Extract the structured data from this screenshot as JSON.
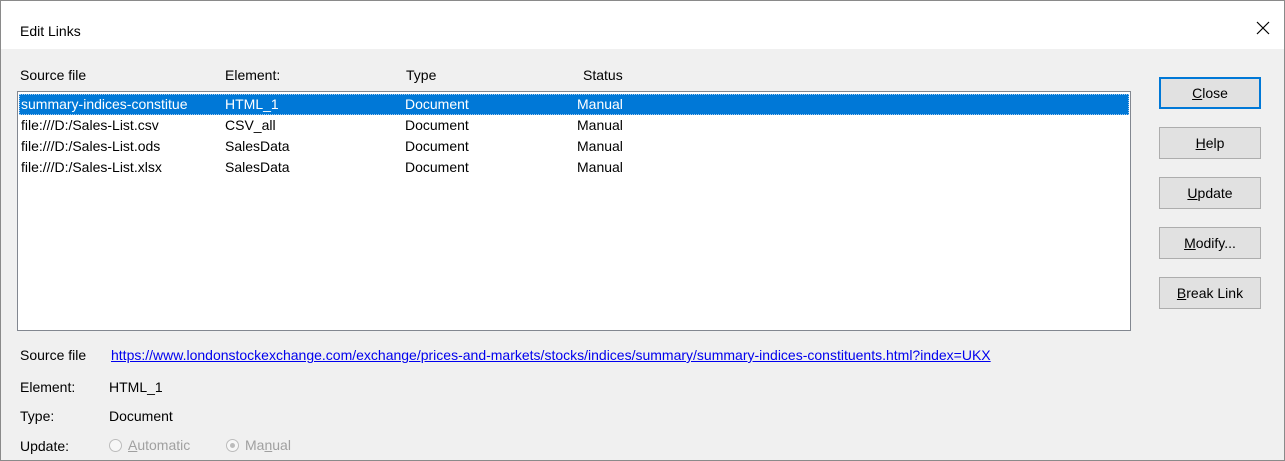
{
  "window": {
    "title": "Edit Links"
  },
  "columns": {
    "source": "Source file",
    "element": "Element:",
    "type": "Type",
    "status": "Status"
  },
  "links": [
    {
      "source": "summary-indices-constitue",
      "element": "HTML_1",
      "type": "Document",
      "status": "Manual"
    },
    {
      "source": "file:///D:/Sales-List.csv",
      "element": "CSV_all",
      "type": "Document",
      "status": "Manual"
    },
    {
      "source": "file:///D:/Sales-List.ods",
      "element": "SalesData",
      "type": "Document",
      "status": "Manual"
    },
    {
      "source": "file:///D:/Sales-List.xlsx",
      "element": "SalesData",
      "type": "Document",
      "status": "Manual"
    }
  ],
  "buttons": {
    "close": {
      "mnemonic": "C",
      "rest": "lose"
    },
    "help": {
      "mnemonic": "H",
      "rest": "elp"
    },
    "update": {
      "mnemonic": "U",
      "rest": "pdate"
    },
    "modify": {
      "mnemonic": "M",
      "rest": "odify..."
    },
    "break_link": {
      "mnemonic": "B",
      "rest": "reak Link"
    }
  },
  "details": {
    "source_label": "Source file",
    "source_value": "https://www.londonstockexchange.com/exchange/prices-and-markets/stocks/indices/summary/summary-indices-constituents.html?index=UKX",
    "element_label": "Element:",
    "element_value": "HTML_1",
    "type_label": "Type:",
    "type_value": "Document",
    "update_label": "Update:",
    "automatic": {
      "mnemonic": "A",
      "rest": "utomatic"
    },
    "manual": {
      "before": "Ma",
      "mnemonic": "n",
      "after": "ual"
    },
    "selected_update": "manual"
  },
  "colors": {
    "selection": "#0078d7",
    "link": "#0000ee",
    "default_button_border": "#0078d7"
  }
}
